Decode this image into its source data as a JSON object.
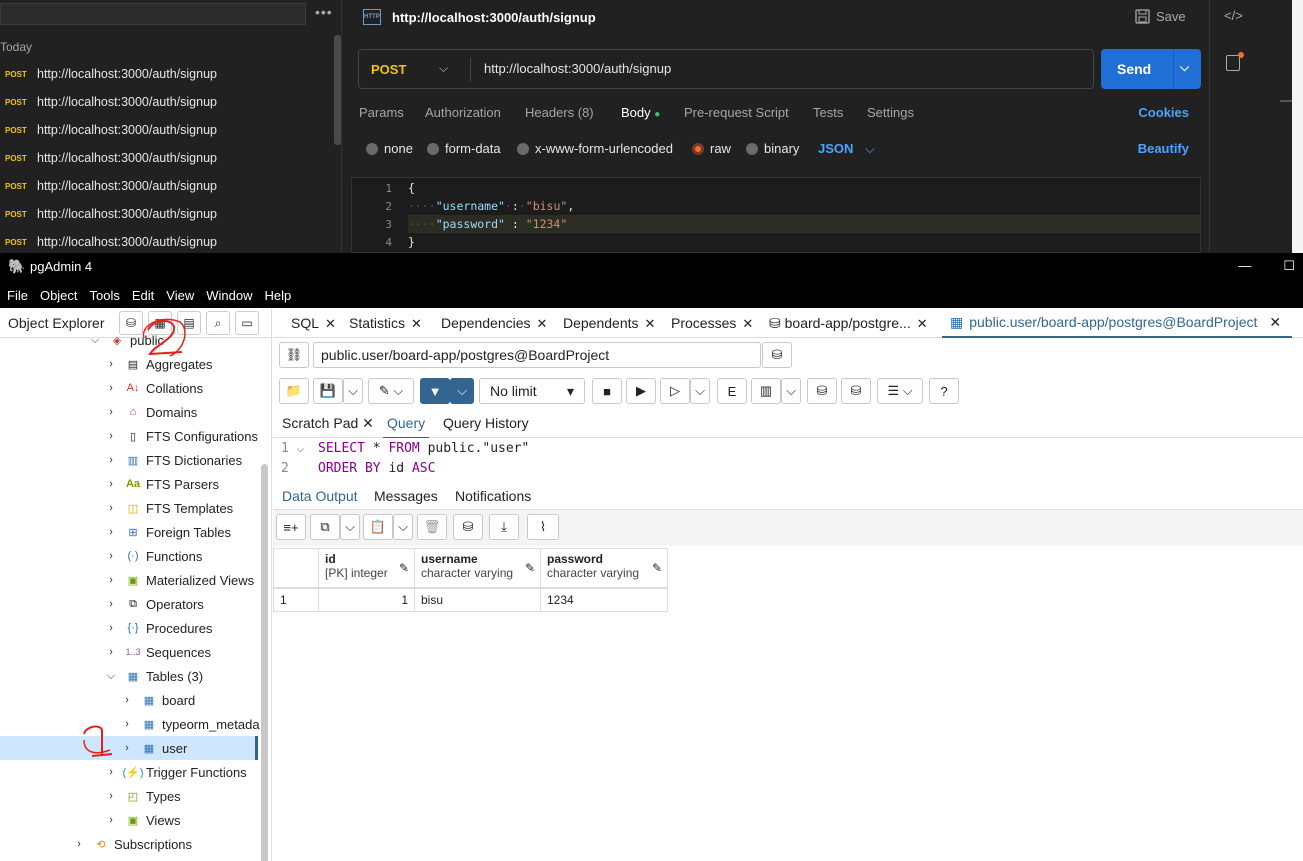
{
  "postman": {
    "today_label": "Today",
    "history": [
      {
        "method": "POST",
        "url": "http://localhost:3000/auth/signup"
      },
      {
        "method": "POST",
        "url": "http://localhost:3000/auth/signup"
      },
      {
        "method": "POST",
        "url": "http://localhost:3000/auth/signup"
      },
      {
        "method": "POST",
        "url": "http://localhost:3000/auth/signup"
      },
      {
        "method": "POST",
        "url": "http://localhost:3000/auth/signup"
      },
      {
        "method": "POST",
        "url": "http://localhost:3000/auth/signup"
      },
      {
        "method": "POST",
        "url": "http://localhost:3000/auth/signup"
      }
    ],
    "request_title": "http://localhost:3000/auth/signup",
    "http_badge": "HTTP",
    "save_label": "Save",
    "method": "POST",
    "url": "http://localhost:3000/auth/signup",
    "send_label": "Send",
    "tabs": [
      "Params",
      "Authorization",
      "Headers (8)",
      "Body",
      "Pre-request Script",
      "Tests",
      "Settings"
    ],
    "cookies_label": "Cookies",
    "body_types": [
      "none",
      "form-data",
      "x-www-form-urlencoded",
      "raw",
      "binary"
    ],
    "selected_body_type": "raw",
    "format": "JSON",
    "beautify_label": "Beautify",
    "editor_lines": [
      "1",
      "2",
      "3",
      "4"
    ],
    "code": {
      "l1": "{",
      "key1": "\"username\"",
      "val1": "\"bisu\"",
      "key2": "\"password\"",
      "val2": "\"1234\"",
      "l4": "}"
    }
  },
  "pgadmin": {
    "title": "pgAdmin 4",
    "menu": [
      "File",
      "Object",
      "Tools",
      "Edit",
      "View",
      "Window",
      "Help"
    ],
    "object_explorer": "Object Explorer",
    "tree": {
      "schema": "public",
      "items": [
        "Aggregates",
        "Collations",
        "Domains",
        "FTS Configurations",
        "FTS Dictionaries",
        "FTS Parsers",
        "FTS Templates",
        "Foreign Tables",
        "Functions",
        "Materialized Views",
        "Operators",
        "Procedures",
        "Sequences"
      ],
      "tables": "Tables (3)",
      "table_children": [
        "board",
        "typeorm_metada",
        "user"
      ],
      "after": [
        "Trigger Functions",
        "Types",
        "Views"
      ],
      "subscriptions": "Subscriptions"
    },
    "tabs": [
      "SQL",
      "Statistics",
      "Dependencies",
      "Dependents",
      "Processes",
      "board-app/postgre..."
    ],
    "active_tab": "public.user/board-app/postgres@BoardProject",
    "connection": "public.user/board-app/postgres@BoardProject",
    "limit": "No limit",
    "query_tabs": [
      "Scratch Pad",
      "Query",
      "Query History"
    ],
    "query_lines": [
      "1",
      "2"
    ],
    "query": {
      "select": "SELECT",
      "star": " * ",
      "from": "FROM",
      "table": " public.\"user\"",
      "order": "ORDER BY",
      "col": " id ",
      "asc": "ASC"
    },
    "output_tabs": [
      "Data Output",
      "Messages",
      "Notifications"
    ],
    "columns": [
      {
        "name": "id",
        "type": "[PK] integer"
      },
      {
        "name": "username",
        "type": "character varying"
      },
      {
        "name": "password",
        "type": "character varying"
      }
    ],
    "rows": [
      {
        "num": "1",
        "id": "1",
        "username": "bisu",
        "password": "1234"
      }
    ],
    "colors": {
      "accent": "#326690",
      "postman_send": "#1f6fd6",
      "post_method": "#f1c40f",
      "annotation": "#e8201c"
    }
  }
}
